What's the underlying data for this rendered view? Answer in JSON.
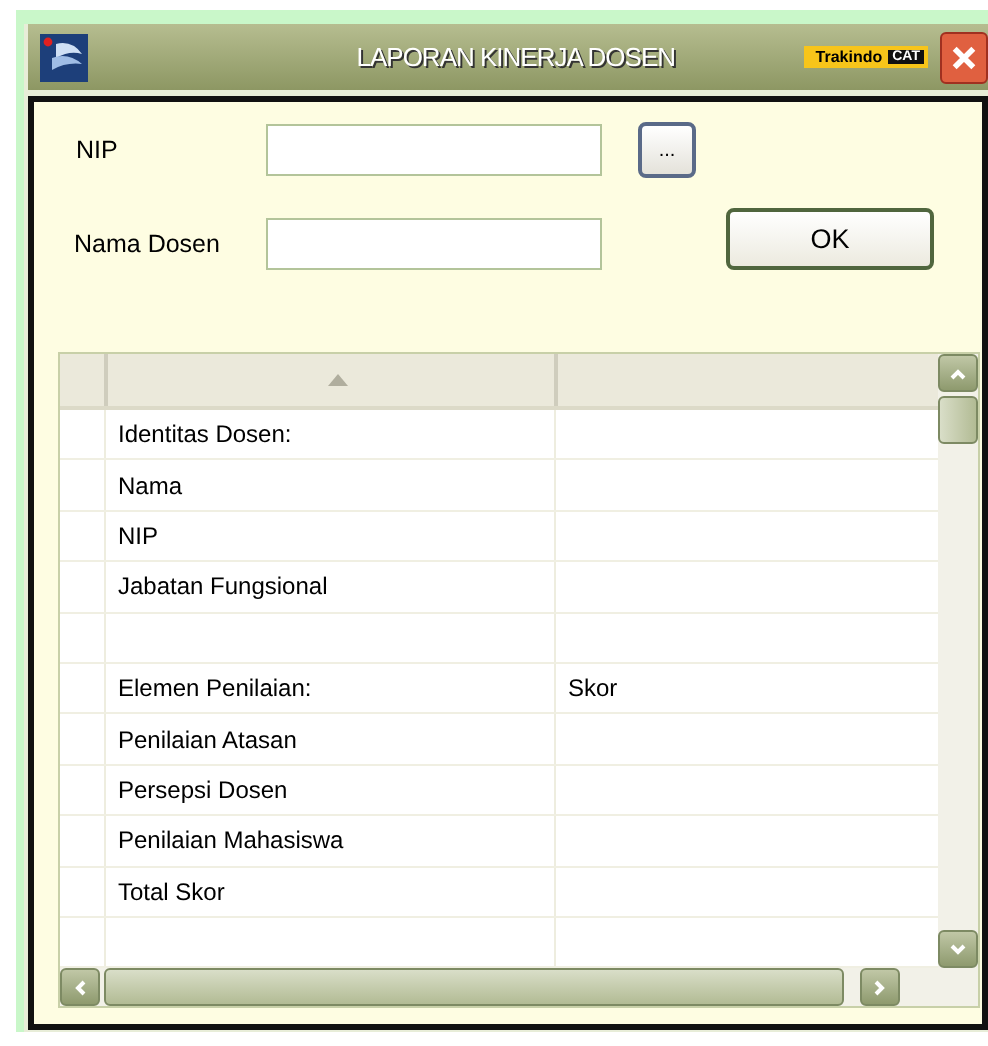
{
  "window": {
    "title": "LAPORAN KINERJA DOSEN",
    "brand": {
      "name": "Trakindo",
      "mark": "CAT"
    }
  },
  "form": {
    "fields": [
      {
        "label": "NIP",
        "browse_button": "..."
      },
      {
        "label": "Nama Dosen"
      }
    ],
    "ok_button": "OK"
  },
  "table": {
    "columns": [
      {
        "sorted": true
      },
      {
        "sorted": false
      }
    ],
    "rows": [
      {
        "column_1": "Identitas Dosen:"
      },
      {
        "column_1": "Nama"
      },
      {
        "column_1": "NIP"
      },
      {
        "column_1": "Jabatan Fungsional"
      },
      {},
      {
        "column_1": "Elemen Penilaian:",
        "column_2": "Skor"
      },
      {
        "column_1": "Penilaian Atasan"
      },
      {
        "column_1": "Persepsi Dosen"
      },
      {
        "column_1": "Penilaian Mahasiswa"
      },
      {
        "column_1": "Total Skor"
      },
      {}
    ]
  }
}
